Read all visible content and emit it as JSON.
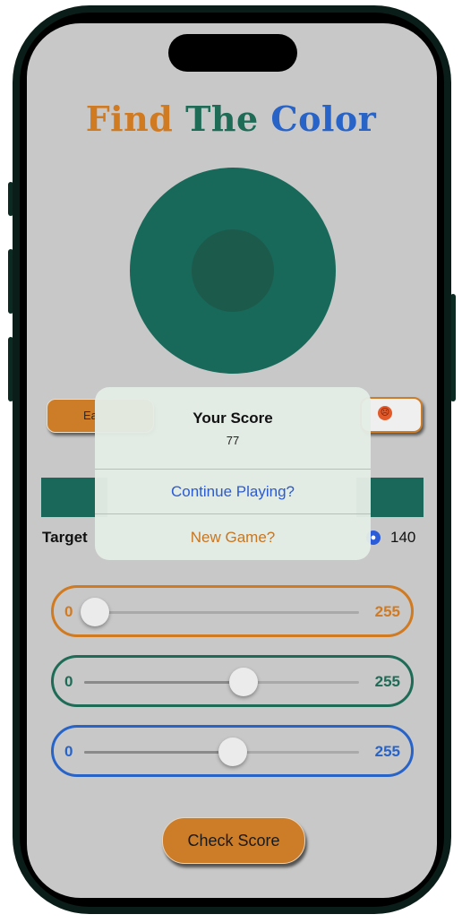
{
  "header": {
    "title_word1": "Find",
    "title_word2": "The",
    "title_word3": "Color"
  },
  "colors": {
    "orange": "#d07a22",
    "green": "#1e6b56",
    "blue": "#2864c8",
    "target": "#18695a"
  },
  "mode_buttons": {
    "left_label": "Ea",
    "right_icon": "angry-face-icon"
  },
  "target_row": {
    "label": "Target",
    "value": "140"
  },
  "sliders": [
    {
      "color": "orange",
      "min": "0",
      "max": "255",
      "value_fraction": 0.04
    },
    {
      "color": "green",
      "min": "0",
      "max": "255",
      "value_fraction": 0.58
    },
    {
      "color": "blue",
      "min": "0",
      "max": "255",
      "value_fraction": 0.54
    }
  ],
  "check_button": {
    "label": "Check Score"
  },
  "alert": {
    "title": "Your Score",
    "message": "77",
    "continue_label": "Continue Playing?",
    "new_game_label": "New Game?"
  }
}
